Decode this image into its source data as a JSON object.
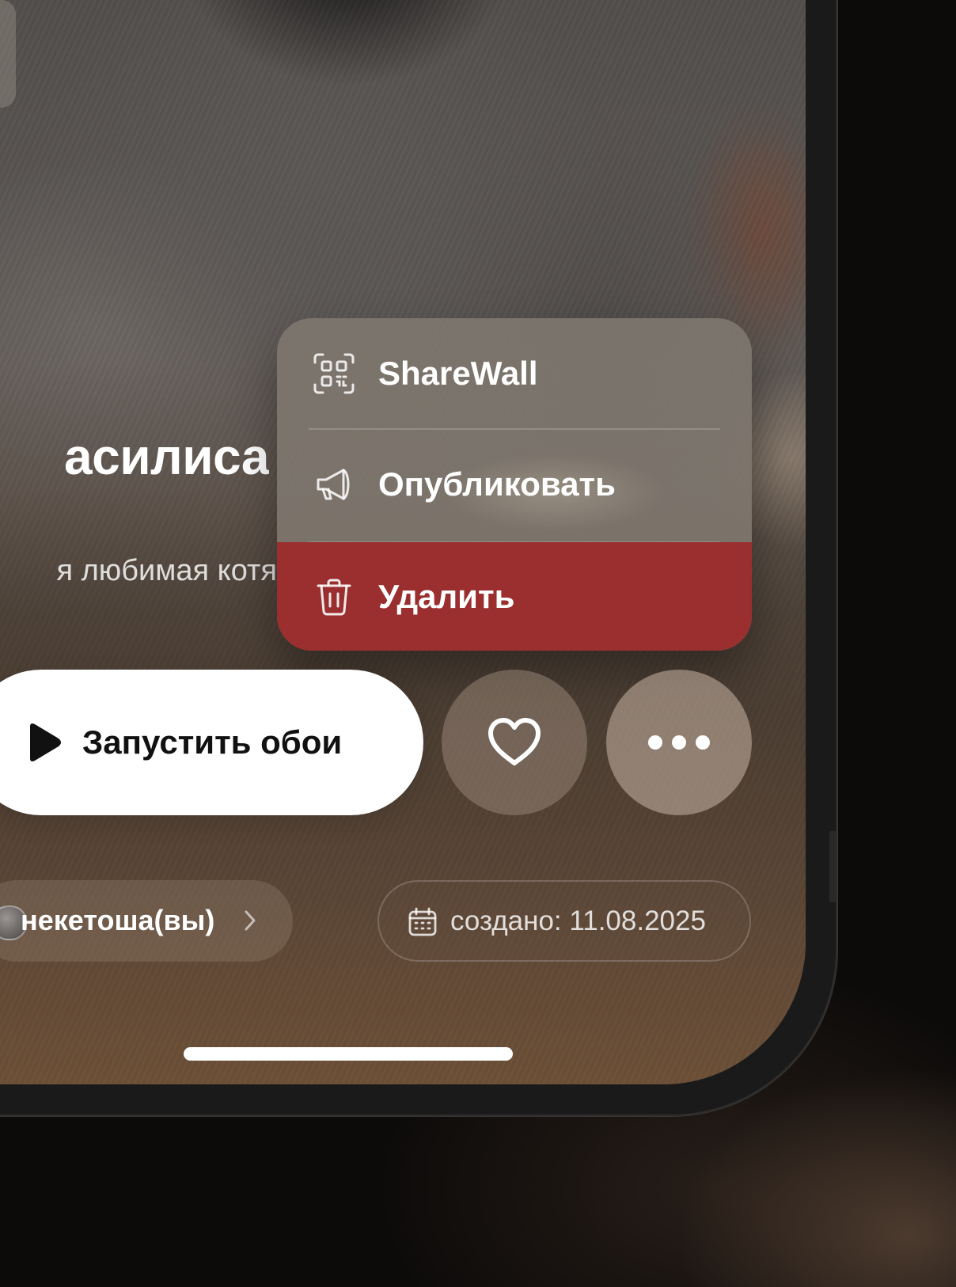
{
  "wallpaper": {
    "title": "асилиса",
    "subtitle": "я любимая котя"
  },
  "context_menu": {
    "items": [
      {
        "label": "ShareWall",
        "icon": "qr-code-icon"
      },
      {
        "label": "Опубликовать",
        "icon": "megaphone-icon"
      },
      {
        "label": "Удалить",
        "icon": "trash-icon"
      }
    ],
    "delete_color": "#9b2f2f"
  },
  "actions": {
    "play_label": "Запустить обои",
    "play_icon": "play-icon",
    "like_icon": "heart-icon",
    "more_icon": "more-dots-icon"
  },
  "author": {
    "name": "некетоша(вы)",
    "icon": "chevron-right-icon"
  },
  "created": {
    "text": "создано: 11.08.2025",
    "icon": "calendar-icon"
  }
}
